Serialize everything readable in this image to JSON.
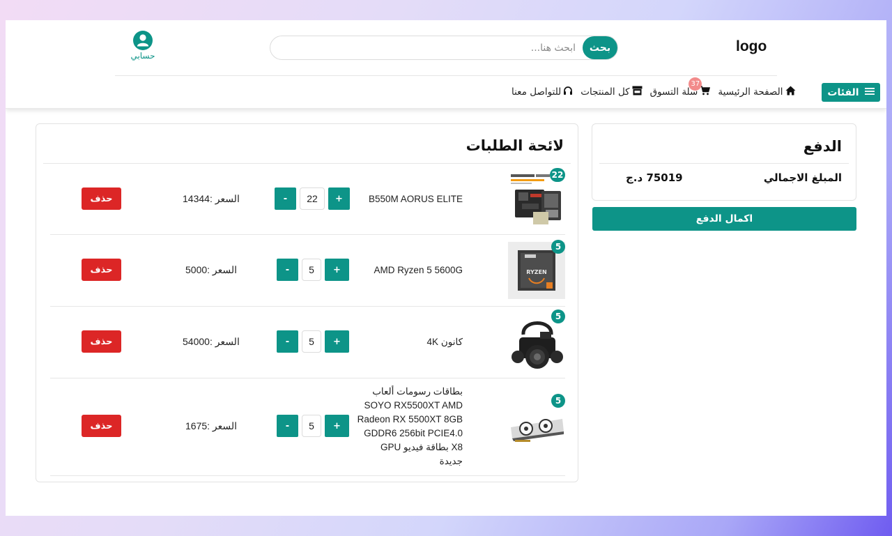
{
  "header": {
    "logo": "logo",
    "search": {
      "button_label": "بحث",
      "placeholder": "ابحث هنا..."
    },
    "account_label": "حسابي",
    "categories_label": "الفئات",
    "nav": [
      {
        "label": "الصفحة الرئيسية",
        "icon": "home-icon"
      },
      {
        "label": "سلة التسوق",
        "icon": "cart-icon",
        "badge": "37"
      },
      {
        "label": "كل المنتجات",
        "icon": "store-icon"
      },
      {
        "label": "للتواصل معنا",
        "icon": "headset-icon"
      }
    ]
  },
  "payment": {
    "title": "الدفع",
    "total_label": "المبلغ الاجمالي",
    "total_value": "75019 د.ج",
    "checkout_label": "اكمال الدفع"
  },
  "orders": {
    "title": "لائحة الطلبات",
    "plus_label": "+",
    "minus_label": "-",
    "delete_label": "حذف",
    "items": [
      {
        "badge": "22",
        "name": "B550M AORUS ELITE",
        "qty": "22",
        "price": "السعر :14344"
      },
      {
        "badge": "5",
        "name": "AMD Ryzen 5 5600G",
        "qty": "5",
        "price": "السعر :5000"
      },
      {
        "badge": "5",
        "name": "كانون 4K",
        "qty": "5",
        "price": "السعر :54000"
      },
      {
        "badge": "5",
        "name": "بطاقات رسومات ألعاب SOYO RX5500XT AMD Radeon RX 5500XT 8GB GDDR6 256bit PCIE4.0 X8 بطاقة فيديو GPU جديدة",
        "qty": "5",
        "price": "السعر :1675"
      }
    ]
  },
  "colors": {
    "accent": "#0d9488",
    "danger": "#dc2626",
    "badge": "#f28b8b"
  }
}
